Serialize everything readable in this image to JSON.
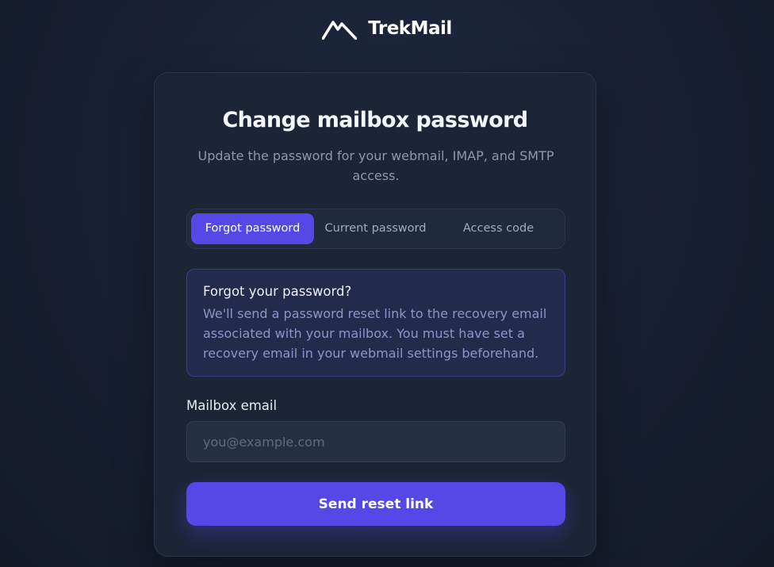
{
  "brand": {
    "name": "TrekMail",
    "logo_icon": "mountain-logo-icon"
  },
  "card": {
    "title": "Change mailbox password",
    "subtitle": "Update the password for your webmail, IMAP, and SMTP access."
  },
  "tabs": [
    {
      "label": "Forgot password",
      "active": true
    },
    {
      "label": "Current password",
      "active": false
    },
    {
      "label": "Access code",
      "active": false
    }
  ],
  "info": {
    "title": "Forgot your password?",
    "text": "We'll send a password reset link to the recovery email associated with your mailbox. You must have set a recovery email in your webmail settings beforehand."
  },
  "form": {
    "email_label": "Mailbox email",
    "email_placeholder": "you@example.com",
    "email_value": "",
    "submit_label": "Send reset link"
  },
  "colors": {
    "accent": "#5548e6",
    "background": "#182133",
    "card": "#1b2536",
    "info_bg": "#232b4c",
    "info_text": "#8b95c9"
  }
}
